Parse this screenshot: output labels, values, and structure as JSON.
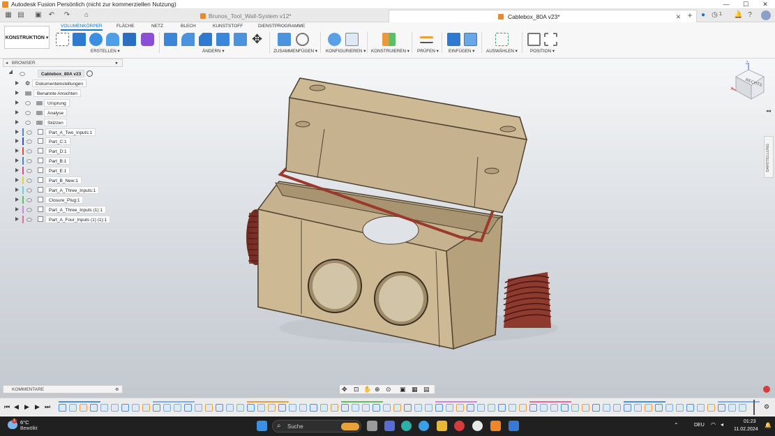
{
  "window": {
    "title": "Autodesk Fusion Persönlich (nicht zur kommerziellen Nutzung)",
    "minimize": "—",
    "maximize": "☐",
    "close": "✕"
  },
  "tabs": [
    {
      "label": "Brunos_Tool_Wall-System v12*"
    },
    {
      "label": "Cablebox_80A v23*"
    }
  ],
  "tabbar_right": {
    "count": "1"
  },
  "ribbon": {
    "workspace": "KONSTRUKTION",
    "tabs": [
      "VOLUMENKÖRPER",
      "FLÄCHE",
      "NETZ",
      "BLECH",
      "KUNSTSTOFF",
      "DIENSTPROGRAMME"
    ],
    "groups": [
      "ERSTELLEN",
      "ÄNDERN",
      "ZUSAMMENFÜGEN",
      "KONFIGURIEREN",
      "KONSTRUIEREN",
      "PRÜFEN",
      "EINFÜGEN",
      "AUSWÄHLEN",
      "POSITION"
    ]
  },
  "browser": {
    "title": "BROWSER",
    "root": "Cablebox_80A v23",
    "items": [
      {
        "label": "Dokumenteinstellungen",
        "kind": "gear"
      },
      {
        "label": "Benannte Ansichten",
        "kind": "folder"
      },
      {
        "label": "Ursprung",
        "kind": "folder"
      },
      {
        "label": "Analyse",
        "kind": "folder"
      },
      {
        "label": "Skizzen",
        "kind": "folder"
      },
      {
        "label": "Part_A_Two_Inputs:1",
        "kind": "component",
        "color": "#5b7fd6"
      },
      {
        "label": "Part_C:1",
        "kind": "component",
        "color": "#3b4fc2"
      },
      {
        "label": "Part_D:1",
        "kind": "component",
        "color": "#d94a4a"
      },
      {
        "label": "Part_B:1",
        "kind": "component",
        "color": "#4c7fd6"
      },
      {
        "label": "Part_E:1",
        "kind": "component",
        "color": "#e24a8b"
      },
      {
        "label": "Part_B_New:1",
        "kind": "component",
        "color": "#e0d23a"
      },
      {
        "label": "Part_A_Three_Inputs:1",
        "kind": "component",
        "color": "#6ad0d6"
      },
      {
        "label": "Closure_Plug:1",
        "kind": "component",
        "color": "#5bc06a"
      },
      {
        "label": "Part_A_Three_Inputs (1):1",
        "kind": "component",
        "color": "#c98ad6"
      },
      {
        "label": "Part_A_Four_Inputs (1) (1):1",
        "kind": "component",
        "color": "#e46aa0"
      }
    ]
  },
  "navcube": {
    "face": "RECHTS",
    "axis_z": "Z",
    "axis_x": "X"
  },
  "side_panel": {
    "label": "DARSTELLUNG"
  },
  "comments": {
    "title": "KOMMENTARE"
  },
  "taskbar": {
    "weather_temp": "6°C",
    "weather_text": "Bewölkt",
    "search_placeholder": "Suche",
    "language": "DEU",
    "time": "01:23",
    "date": "11.02.2024",
    "notification_count": "1"
  },
  "colors": {
    "accent": "#1a73c7",
    "box_body": "#c9b592",
    "box_dark": "#a8946f",
    "gasket": "#9b3a2c",
    "taskbar": "#202020"
  }
}
